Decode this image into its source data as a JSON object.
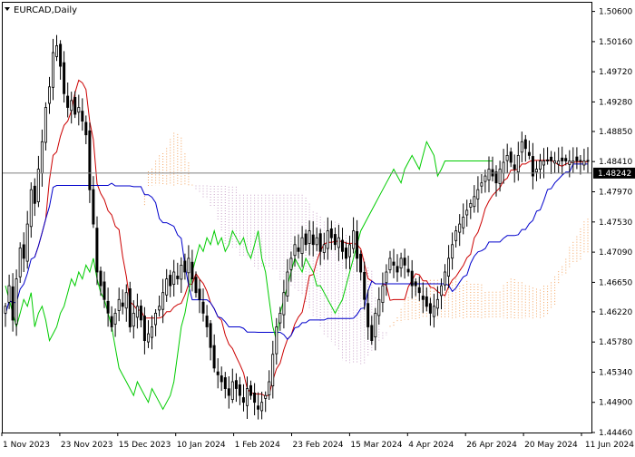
{
  "chart_data": {
    "type": "candlestick",
    "title": "EURCAD,Daily",
    "last_price": "1.48242",
    "ylim": [
      1.4446,
      1.5074
    ],
    "y_ticks": [
      "1.50600",
      "1.50160",
      "1.49720",
      "1.49280",
      "1.48850",
      "1.48410",
      "1.47970",
      "1.47530",
      "1.47090",
      "1.46650",
      "1.46220",
      "1.45780",
      "1.45340",
      "1.44900",
      "1.44460"
    ],
    "x_ticks": [
      "1 Nov 2023",
      "23 Nov 2023",
      "15 Dec 2023",
      "10 Jan 2024",
      "1 Feb 2024",
      "23 Feb 2024",
      "15 Mar 2024",
      "4 Apr 2024",
      "26 Apr 2024",
      "20 May 2024",
      "11 Jun 2024"
    ],
    "indicator": "Ichimoku Kinko Hyo",
    "colors": {
      "bull_candle": "#000000",
      "bear_candle": "#000000",
      "tenkan_sen": "#cc0000",
      "kijun_sen": "#0000cc",
      "chikou_span": "#00cc00",
      "kumo_bullish": "#f4a460",
      "kumo_bearish": "#c8a2c8",
      "last_price_line": "#808080"
    },
    "bar_count": 160,
    "cloud_shift": 26,
    "closes": [
      1.463,
      1.466,
      1.461,
      1.467,
      1.4715,
      1.47,
      1.475,
      1.48,
      1.478,
      1.483,
      1.487,
      1.492,
      1.495,
      1.5,
      1.501,
      1.498,
      1.494,
      1.492,
      1.493,
      1.491,
      1.492,
      1.49,
      1.488,
      1.48,
      1.475,
      1.468,
      1.466,
      1.464,
      1.462,
      1.46,
      1.462,
      1.464,
      1.463,
      1.465,
      1.46,
      1.462,
      1.463,
      1.461,
      1.458,
      1.459,
      1.46,
      1.462,
      1.463,
      1.465,
      1.467,
      1.466,
      1.468,
      1.467,
      1.469,
      1.468,
      1.47,
      1.467,
      1.465,
      1.464,
      1.462,
      1.46,
      1.457,
      1.454,
      1.453,
      1.452,
      1.451,
      1.45,
      1.452,
      1.451,
      1.45,
      1.449,
      1.451,
      1.45,
      1.449,
      1.448,
      1.449,
      1.45,
      1.452,
      1.456,
      1.46,
      1.462,
      1.465,
      1.468,
      1.47,
      1.472,
      1.471,
      1.473,
      1.472,
      1.474,
      1.472,
      1.473,
      1.471,
      1.472,
      1.474,
      1.473,
      1.472,
      1.473,
      1.471,
      1.47,
      1.472,
      1.474,
      1.47,
      1.468,
      1.464,
      1.46,
      1.458,
      1.462,
      1.464,
      1.466,
      1.468,
      1.47,
      1.469,
      1.468,
      1.47,
      1.469,
      1.468,
      1.466,
      1.466,
      1.465,
      1.464,
      1.463,
      1.462,
      1.463,
      1.464,
      1.466,
      1.468,
      1.47,
      1.472,
      1.474,
      1.475,
      1.476,
      1.477,
      1.478,
      1.479,
      1.48,
      1.481,
      1.482,
      1.483,
      1.482,
      1.481,
      1.483,
      1.484,
      1.485,
      1.484,
      1.483,
      1.485,
      1.487,
      1.486,
      1.485,
      1.482,
      1.483,
      1.4842
    ]
  }
}
